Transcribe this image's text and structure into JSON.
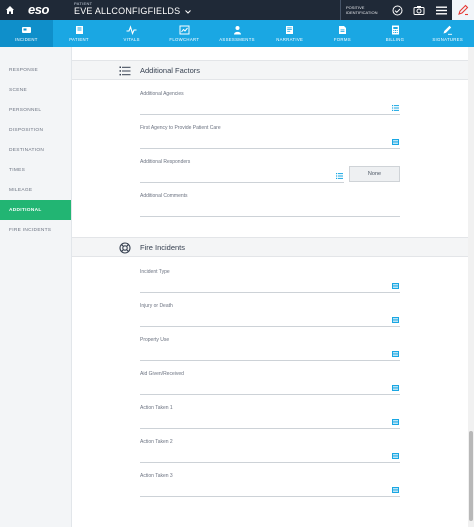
{
  "topbar": {
    "brand": "eso",
    "patient_label": "PATIENT",
    "patient_name": "EVE ALLCONFIGFIELDS",
    "positive_id": "POSITIVE IDENTIFICATION"
  },
  "tabs": [
    {
      "label": "INCIDENT",
      "icon": "incident-icon",
      "active": true
    },
    {
      "label": "PATIENT",
      "icon": "patient-icon"
    },
    {
      "label": "VITALS",
      "icon": "vitals-icon"
    },
    {
      "label": "FLOWCHART",
      "icon": "flowchart-icon"
    },
    {
      "label": "ASSESSMENTS",
      "icon": "assessments-icon"
    },
    {
      "label": "NARRATIVE",
      "icon": "narrative-icon"
    },
    {
      "label": "FORMS",
      "icon": "forms-icon"
    },
    {
      "label": "BILLING",
      "icon": "billing-icon"
    },
    {
      "label": "SIGNATURES",
      "icon": "signatures-icon"
    }
  ],
  "sidebar": {
    "items": [
      {
        "label": "RESPONSE"
      },
      {
        "label": "SCENE"
      },
      {
        "label": "PERSONNEL"
      },
      {
        "label": "DISPOSITION"
      },
      {
        "label": "DESTINATION"
      },
      {
        "label": "TIMES"
      },
      {
        "label": "MILEAGE"
      },
      {
        "label": "ADDITIONAL",
        "active": true
      },
      {
        "label": "FIRE INCIDENTS"
      }
    ]
  },
  "additional": {
    "title": "Additional Factors",
    "fields": [
      {
        "label": "Additional Agencies",
        "value": ""
      },
      {
        "label": "First Agency to Provide Patient Care",
        "value": ""
      },
      {
        "label": "Additional Responders",
        "value": ""
      },
      {
        "label": "Additional Comments",
        "value": ""
      }
    ],
    "none_button": "None"
  },
  "fire": {
    "title": "Fire Incidents",
    "fields": [
      {
        "label": "Incident Type",
        "value": ""
      },
      {
        "label": "Injury or Death",
        "value": ""
      },
      {
        "label": "Property Use",
        "value": ""
      },
      {
        "label": "Aid Given/Received",
        "value": ""
      },
      {
        "label": "Action Taken 1",
        "value": ""
      },
      {
        "label": "Action Taken 2",
        "value": ""
      },
      {
        "label": "Action Taken 3",
        "value": ""
      }
    ]
  },
  "colors": {
    "topbar": "#1f2937",
    "tabbar": "#1aa7e3",
    "tab_active": "#0f8fca",
    "sidebar_active": "#22b573",
    "alert": "#e53935",
    "list_icon": "#1aa7e3"
  }
}
